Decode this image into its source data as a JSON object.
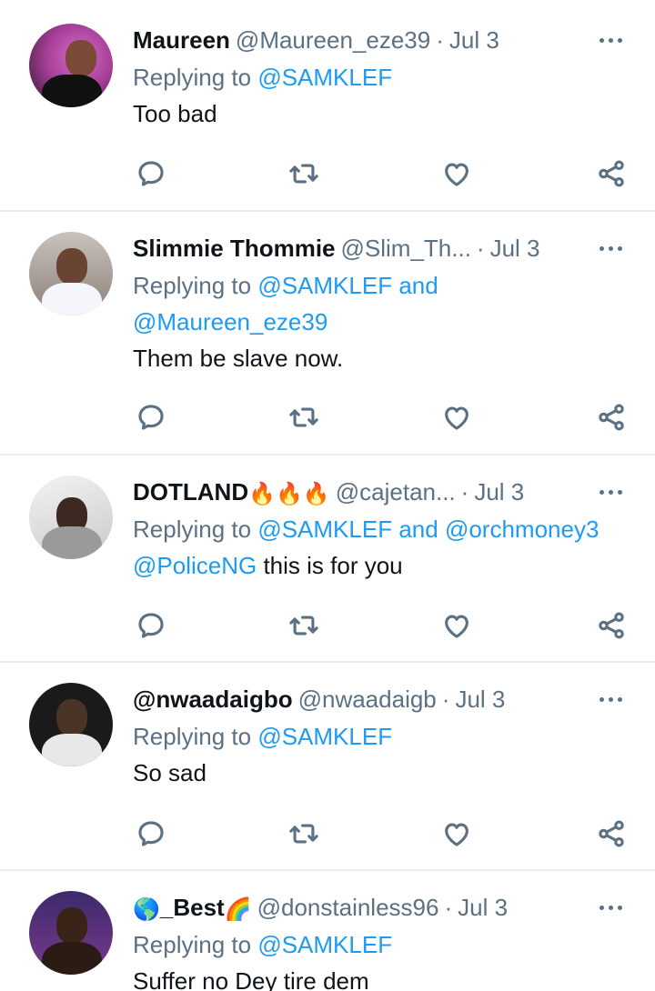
{
  "tweets": [
    {
      "name": "Maureen",
      "handle": "@Maureen_eze39",
      "date": "Jul 3",
      "reply_prefix": "Replying to",
      "reply_mention1": "@SAMKLEF",
      "text": "Too bad"
    },
    {
      "name": "Slimmie Thommie",
      "handle": "@Slim_Th...",
      "date": "Jul 3",
      "reply_prefix": "Replying to",
      "reply_mention1": "@SAMKLEF",
      "reply_and": "and",
      "reply_mention2": "@Maureen_eze39",
      "text": "Them be slave now."
    },
    {
      "name": "DOTLAND",
      "name_emoji": "🔥🔥🔥",
      "handle": "@cajetan...",
      "date": "Jul 3",
      "reply_prefix": "Replying to",
      "reply_mention1": "@SAMKLEF",
      "reply_and": "and",
      "reply_mention2": "@orchmoney3",
      "text_mention": "@PoliceNG",
      "text": "this is for you"
    },
    {
      "name": "@nwaadaigbo",
      "handle": "@nwaadaigb",
      "date": "Jul 3",
      "reply_prefix": "Replying to",
      "reply_mention1": "@SAMKLEF",
      "text": "So sad"
    },
    {
      "name_emoji_pre": "🌎",
      "name": "_Best",
      "name_emoji": "🌈",
      "handle": "@donstainless96",
      "date": "Jul 3",
      "reply_prefix": "Replying to",
      "reply_mention1": "@SAMKLEF",
      "text": "Suffer no Dey tire dem"
    }
  ],
  "icons": {
    "more": "more-horizontal-icon",
    "reply": "reply-icon",
    "retweet": "retweet-icon",
    "like": "like-icon",
    "share": "share-icon"
  },
  "colors": {
    "text": "#0f1419",
    "secondary": "#5b7083",
    "accent": "#1d9bf0",
    "divider": "#e6ecf0"
  }
}
